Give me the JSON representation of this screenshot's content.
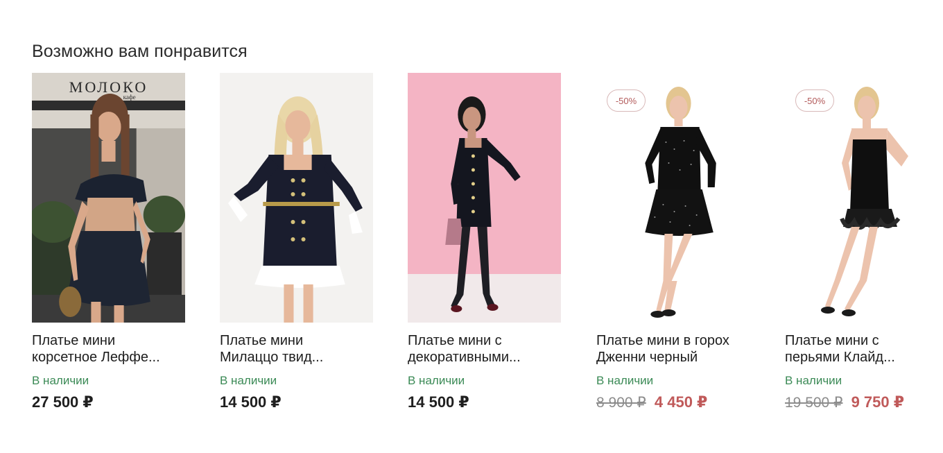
{
  "section": {
    "title": "Возможно вам понравится"
  },
  "products": [
    {
      "name": "Платье мини\nкорсетное Леффе...",
      "stock": "В наличии",
      "price": "27 500 ₽",
      "old_price": "",
      "badge": ""
    },
    {
      "name": "Платье мини\nМилаццо твид...",
      "stock": "В наличии",
      "price": "14 500 ₽",
      "old_price": "",
      "badge": ""
    },
    {
      "name": "Платье мини с\nдекоративными...",
      "stock": "В наличии",
      "price": "14 500 ₽",
      "old_price": "",
      "badge": ""
    },
    {
      "name": "Платье мини в горох\nДженни черный",
      "stock": "В наличии",
      "price": "4 450 ₽",
      "old_price": "8 900 ₽",
      "badge": "-50%"
    },
    {
      "name": "Платье мини с\nперьями Клайд...",
      "stock": "В наличии",
      "price": "9 750 ₽",
      "old_price": "19 500 ₽",
      "badge": "-50%"
    }
  ],
  "photos": [
    {
      "sign": "МОЛОКО",
      "sign_sub": "кафе"
    }
  ],
  "colors": {
    "in_stock": "#3b8a56",
    "sale_price": "#c05a5a",
    "badge_text": "#b25a5a",
    "photo3_bg": "#f4b4c4"
  }
}
